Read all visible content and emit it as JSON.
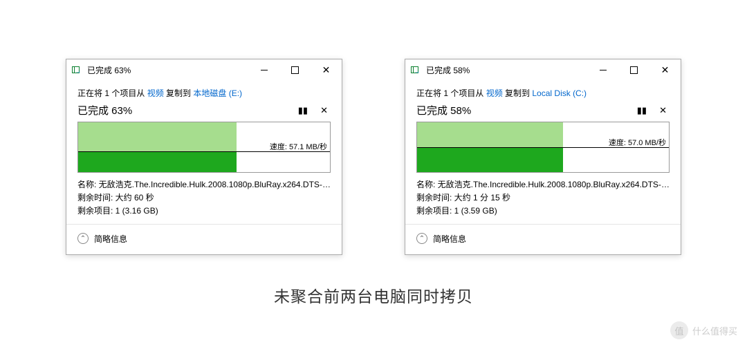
{
  "dialogs": [
    {
      "title": "已完成 63%",
      "desc_prefix": "正在将 1 个项目从 ",
      "source": "视频",
      "desc_mid": " 复制到 ",
      "dest": "本地磁盘 (E:)",
      "progress_label": "已完成 63%",
      "speed_label": "速度: 57.1 MB/秒",
      "name_row": "名称: 无敌浩克.The.Incredible.Hulk.2008.1080p.BluRay.x264.DTS-C...",
      "time_row": "剩余时间: 大约 60 秒",
      "items_row": "剩余项目: 1 (3.16 GB)",
      "footer": "简略信息"
    },
    {
      "title": "已完成 58%",
      "desc_prefix": "正在将 1 个项目从 ",
      "source": "视频",
      "desc_mid": " 复制到 ",
      "dest": "Local Disk (C:)",
      "progress_label": "已完成 58%",
      "speed_label": "速度: 57.0 MB/秒",
      "name_row": "名称: 无敌浩克.The.Incredible.Hulk.2008.1080p.BluRay.x264.DTS-CN...",
      "time_row": "剩余时间: 大约 1 分 15 秒",
      "items_row": "剩余项目: 1 (3.59 GB)",
      "footer": "简略信息"
    }
  ],
  "caption": "未聚合前两台电脑同时拷贝",
  "watermark": {
    "badge": "值",
    "text": "什么值得买"
  },
  "chart_data": [
    {
      "type": "area",
      "title": "已完成 63%",
      "percent_complete": 63,
      "speed_mb_s": 57.1,
      "ylabel": "MB/秒",
      "ylim": [
        0,
        100
      ]
    },
    {
      "type": "area",
      "title": "已完成 58%",
      "percent_complete": 58,
      "speed_mb_s": 57.0,
      "ylabel": "MB/秒",
      "ylim": [
        0,
        100
      ]
    }
  ]
}
